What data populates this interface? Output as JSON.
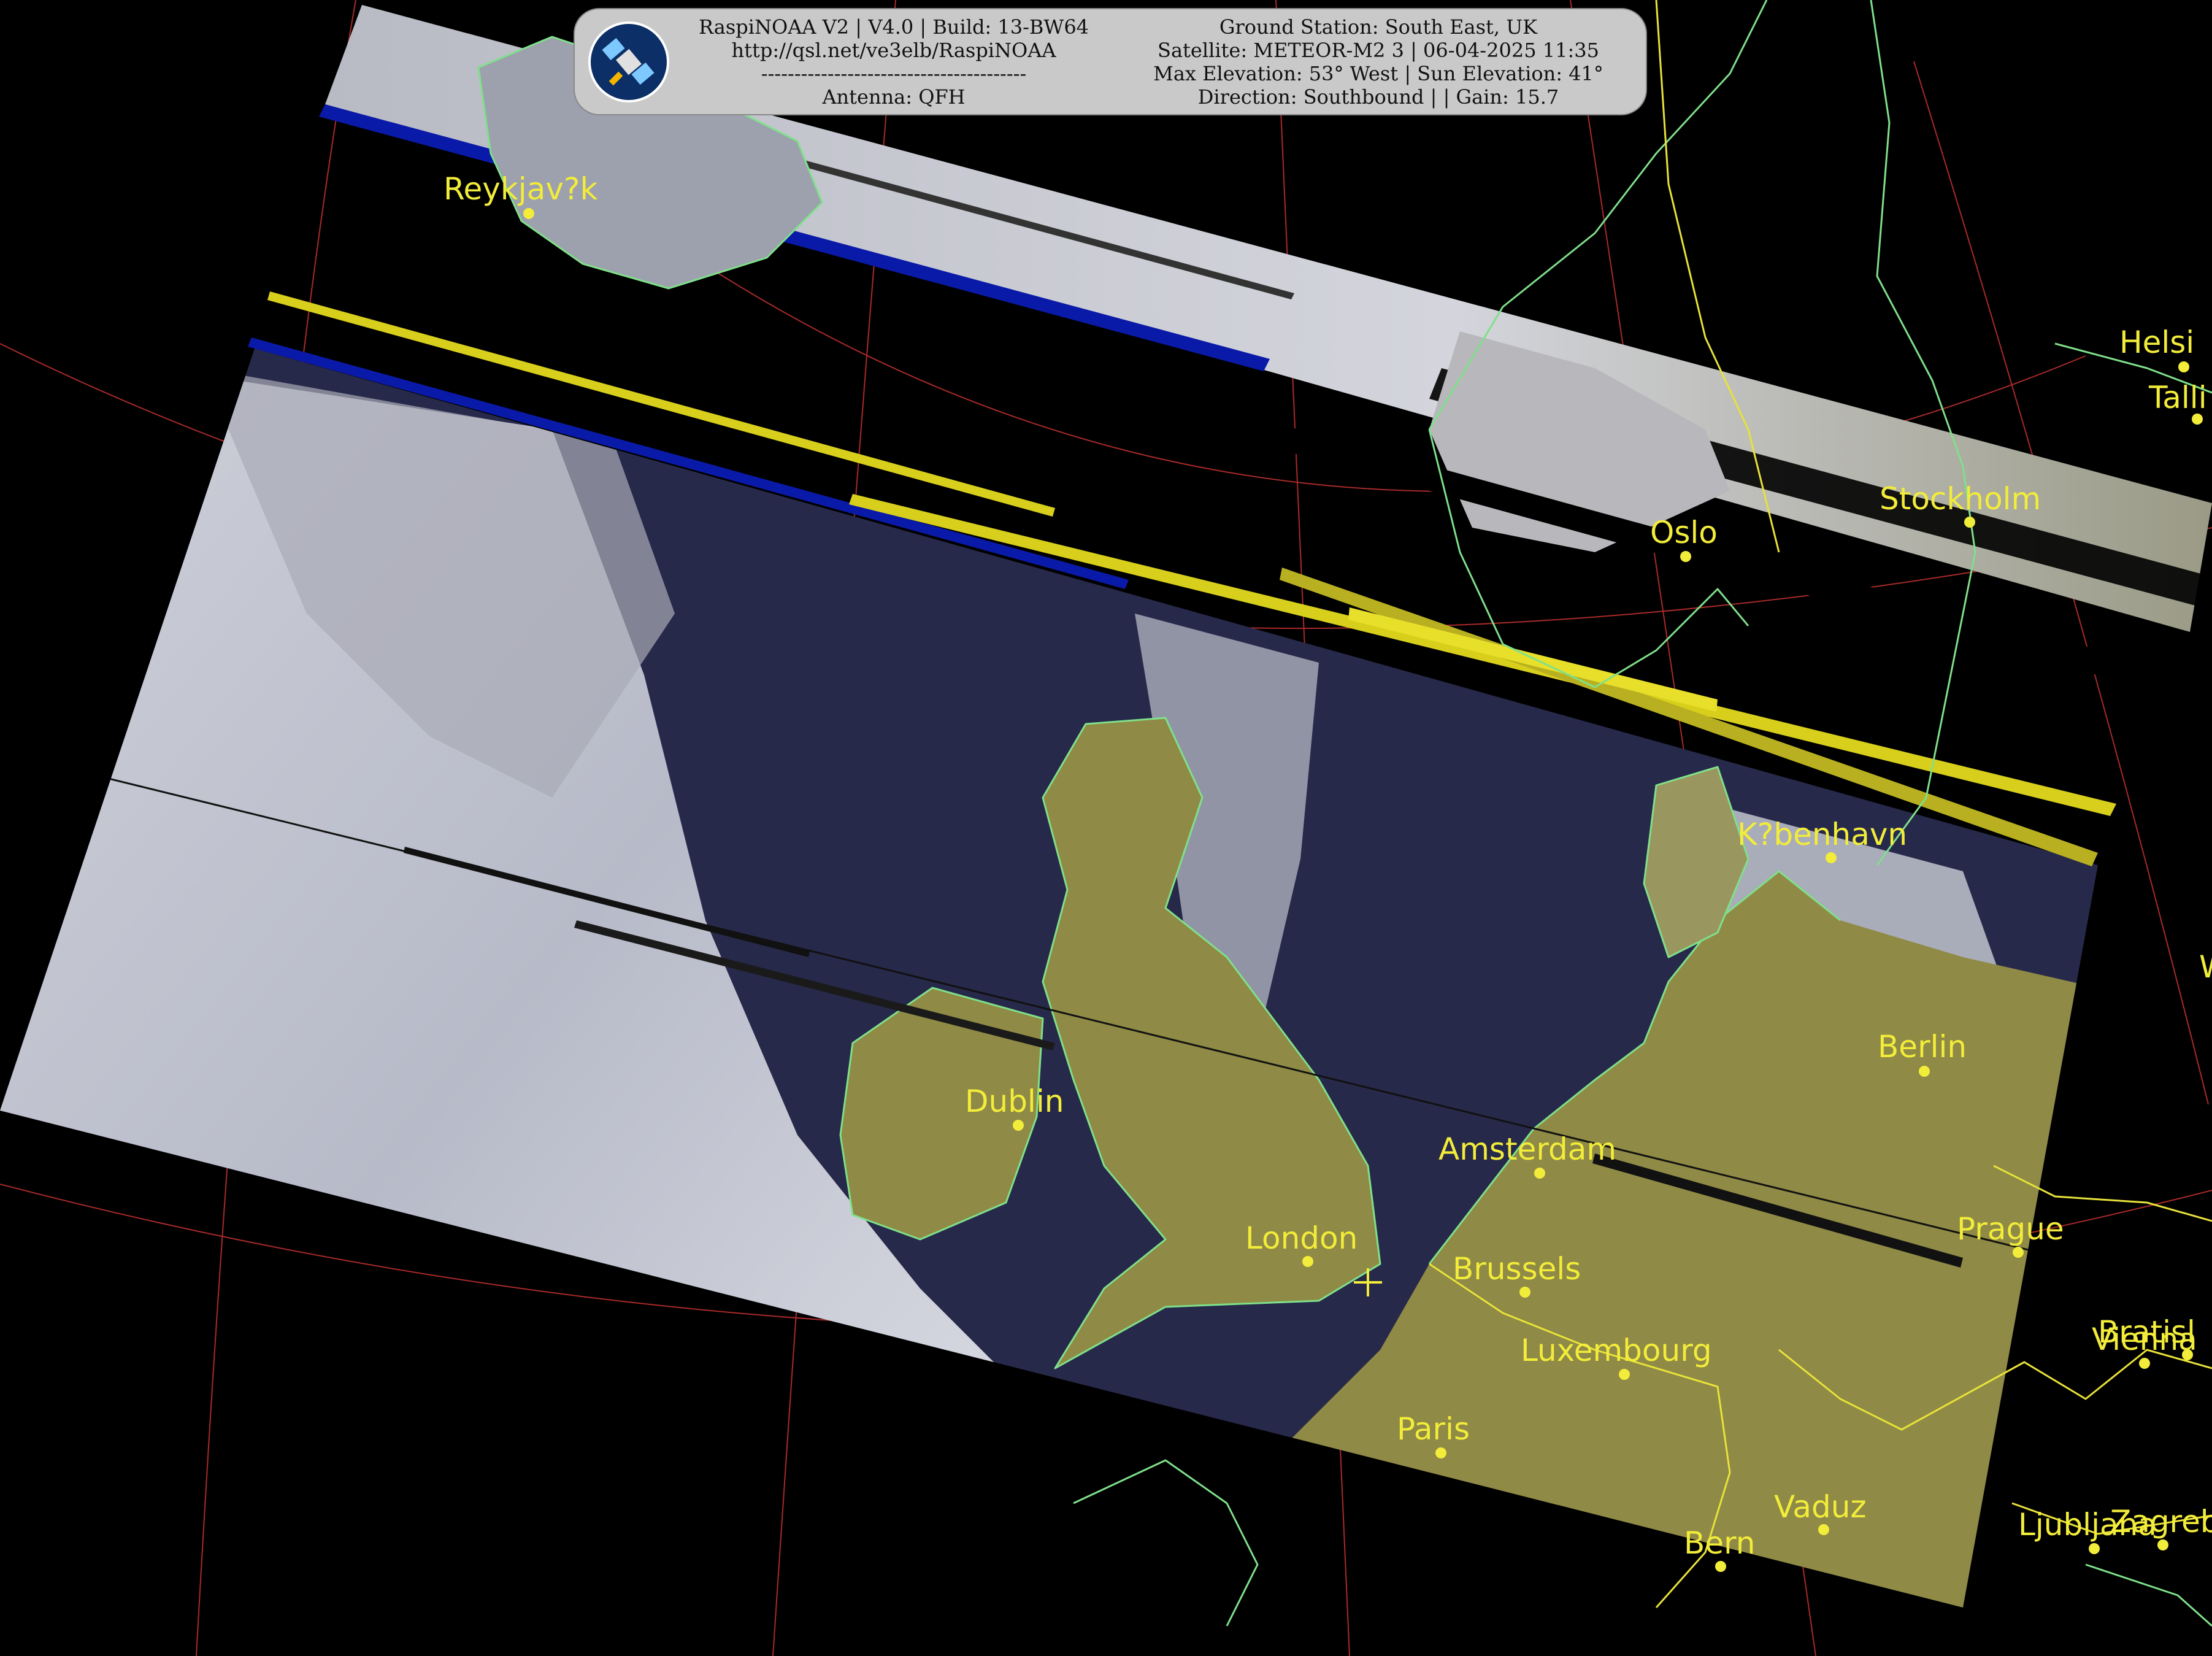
{
  "header": {
    "left_lines": [
      "RaspiNOAA V2 | V4.0 | Build: 13-BW64",
      "http://qsl.net/ve3elb/RaspiNOAA",
      "----------------------------------------",
      "Antenna: QFH"
    ],
    "right_lines": [
      "Ground Station: South East, UK",
      "Satellite: METEOR-M2 3 | 06-04-2025 11:35",
      "Max Elevation: 53° West | Sun Elevation: 41°",
      "Direction: Southbound | | Gain: 15.7"
    ]
  },
  "cities": [
    {
      "name": "Reykjav?k"
    },
    {
      "name": "Oslo"
    },
    {
      "name": "Stockholm"
    },
    {
      "name": "Helsi"
    },
    {
      "name": "Talli"
    },
    {
      "name": "K?benhavn"
    },
    {
      "name": "Dublin"
    },
    {
      "name": "Amsterdam"
    },
    {
      "name": "Berlin"
    },
    {
      "name": "London"
    },
    {
      "name": "Brussels"
    },
    {
      "name": "Prague"
    },
    {
      "name": "Luxembourg"
    },
    {
      "name": "Paris"
    },
    {
      "name": "Vienna"
    },
    {
      "name": "Bratisl"
    },
    {
      "name": "Vaduz"
    },
    {
      "name": "Bern"
    },
    {
      "name": "Ljubljana"
    },
    {
      "name": "Zagreb"
    },
    {
      "name": "W"
    }
  ],
  "colors": {
    "background": "#000000",
    "land": "#8f8a45",
    "sea": "#27294a",
    "cloud": "#c9ccd6",
    "coastline": "#7fe08a",
    "border": "#e8e23a",
    "graticule": "#a82a2a",
    "label": "#f2ec3a",
    "noise_blue": "#0a1aa8",
    "noise_yellow": "#d8cf1c"
  },
  "icons": {
    "logo": "satellite-icon",
    "ground_station_marker": "plus-icon"
  }
}
